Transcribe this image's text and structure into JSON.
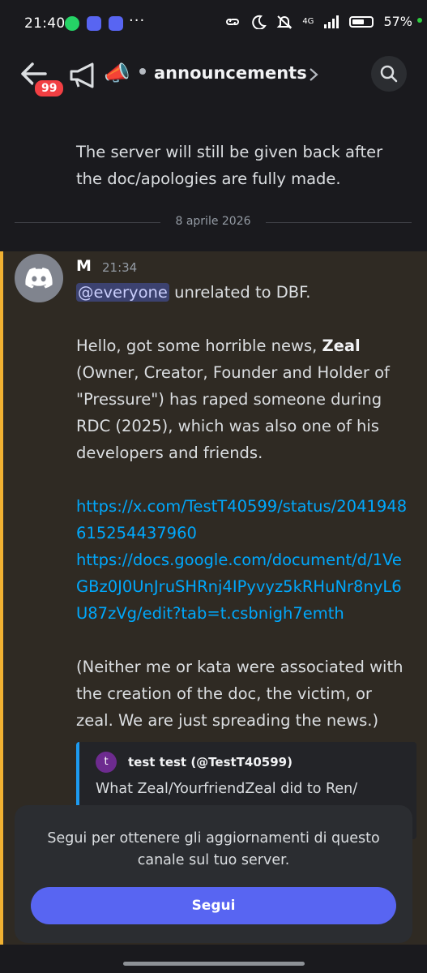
{
  "status_bar": {
    "time": "21:40",
    "dots": "···",
    "network": "4G",
    "battery": "57%",
    "apps": [
      "whatsapp-icon",
      "discord-icon",
      "discord-icon"
    ]
  },
  "header": {
    "unread_badge": "99",
    "channel_icon_emoji": "📣",
    "channel_name": "announcements"
  },
  "previous_message": {
    "text": "The server will still be given back after the doc/apologies are fully made."
  },
  "date_separator": "8 aprile 2026",
  "message": {
    "author": "M",
    "timestamp": "21:34",
    "mention": "@everyone",
    "line1_rest": " unrelated to DBF.",
    "para2_pre": "Hello, got some horrible news, ",
    "para2_bold": "Zeal",
    "para2_post": " (Owner, Creator, Founder and Holder of \"Pressure\") has raped someone during RDC (2025), which was also one of his developers and friends.",
    "link1": "https://x.com/TestT40599/status/2041948615254437960",
    "link2": "https://docs.google.com/document/d/1VeGBz0J0UnJruSHRnj4IPyvyz5kRHuNr8nyL6U87zVg/edit?tab=t.csbnigh7emth",
    "para4": "(Neither me or kata were associated with the creation of the doc, the victim, or zeal. We are just spreading the news.)"
  },
  "embed": {
    "avatar_letter": "t",
    "author": "test test (@TestT40599)",
    "text": "What Zeal/YourfriendZeal did to Ren/"
  },
  "follow_panel": {
    "text": "Segui per ottenere gli aggiornamenti di questo canale sul tuo server.",
    "button_label": "Segui"
  },
  "colors": {
    "background": "#1a1a1e",
    "highlight": "#2f2a23",
    "highlight_bar": "#f0b132",
    "link": "#00a8fc",
    "mention_bg": "#3c4270",
    "button": "#5865f2",
    "badge": "#f23f43"
  }
}
